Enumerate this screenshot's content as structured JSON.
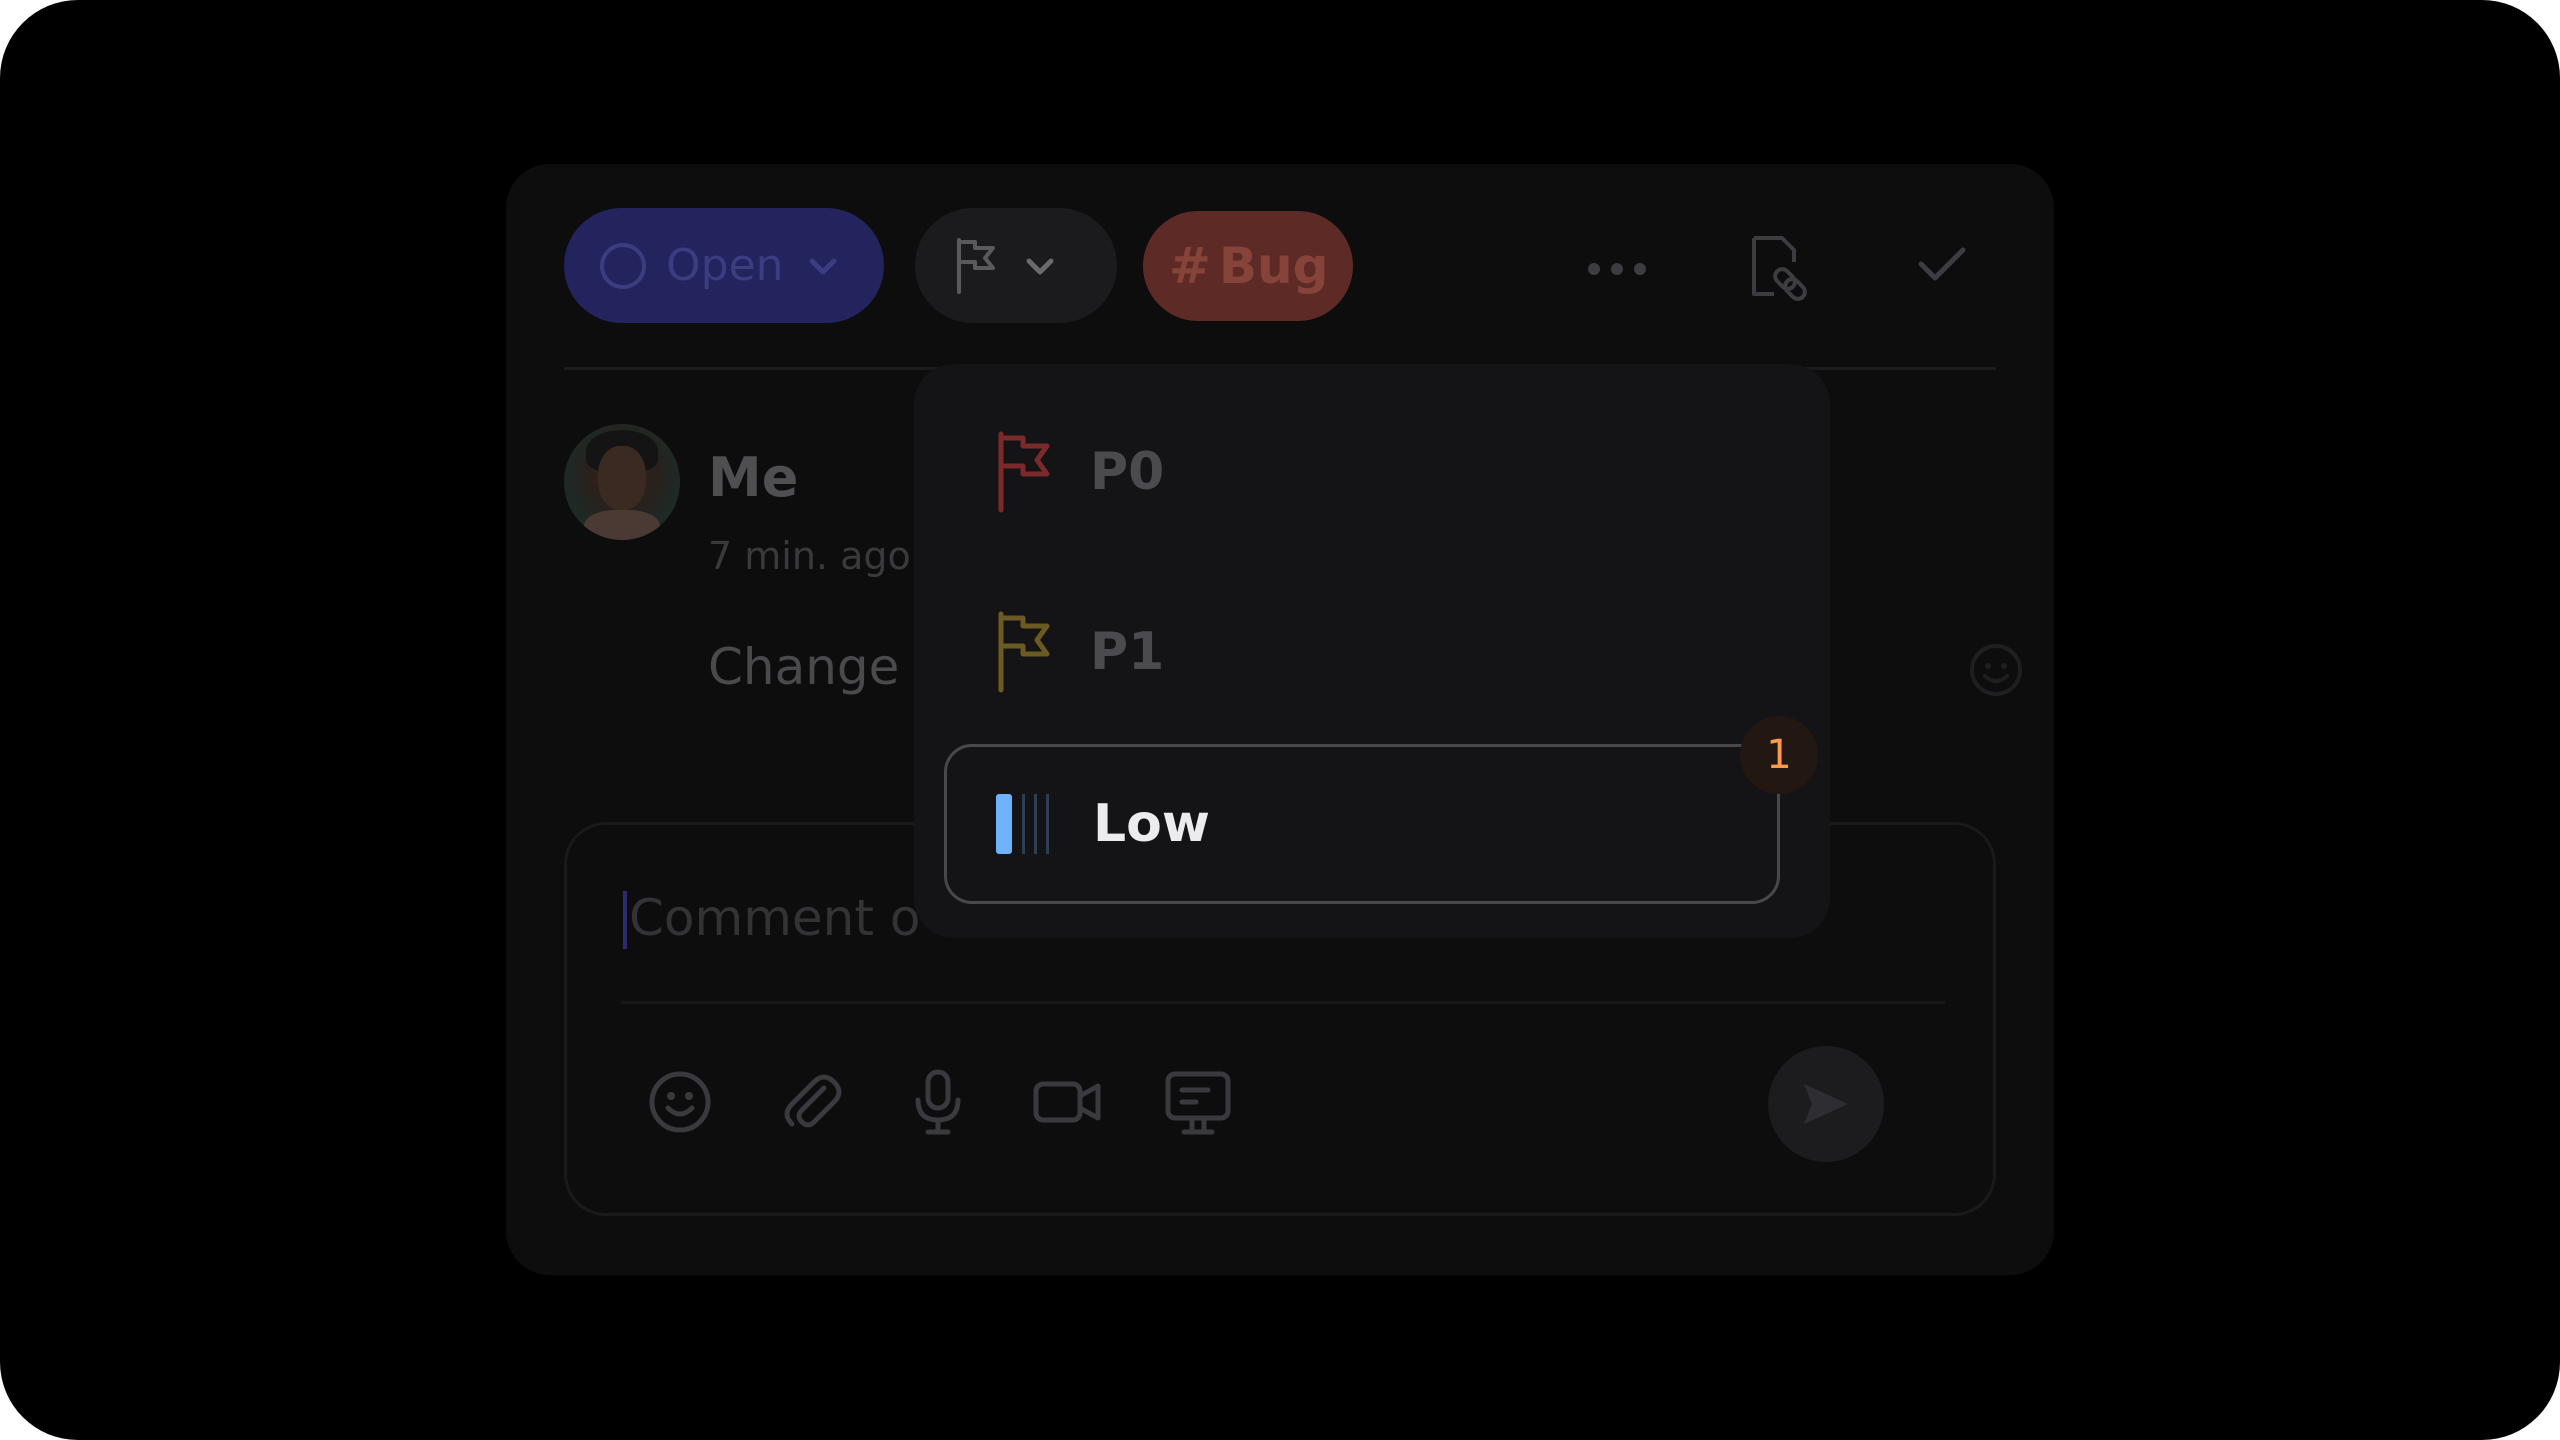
{
  "toolbar": {
    "status_label": "Open",
    "tag_label": "Bug",
    "tag_hash": "#"
  },
  "comment": {
    "author": "Me",
    "time": "7 min. ago",
    "text": "Change"
  },
  "composer": {
    "placeholder": "Comment o"
  },
  "priority_menu": {
    "options": [
      {
        "label": "P0",
        "icon": "flag-icon",
        "color": "#7a2a2a"
      },
      {
        "label": "P1",
        "icon": "flag-icon",
        "color": "#6b5a22"
      },
      {
        "label": "Low",
        "icon": "signal-bars-icon",
        "color": "#6fb3ff",
        "selected": true
      }
    ],
    "badge": "1"
  },
  "colors": {
    "status": "#23235e",
    "tag": "#5e2a26",
    "badge_text": "#ff9a4a",
    "accent_low": "#6fb3ff"
  }
}
